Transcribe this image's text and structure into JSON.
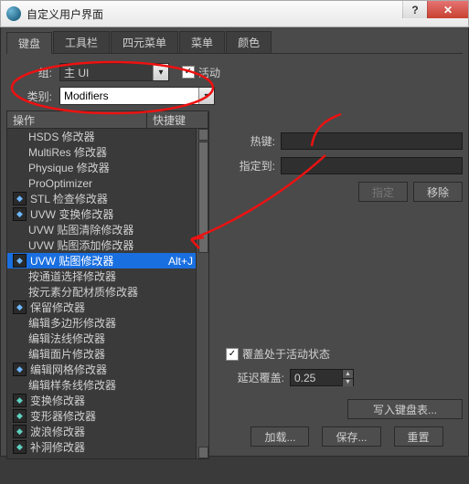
{
  "window": {
    "title": "自定义用户界面"
  },
  "tabs": [
    "键盘",
    "工具栏",
    "四元菜单",
    "菜单",
    "颜色"
  ],
  "active_tab": 0,
  "group": {
    "label": "组:",
    "value": "主 UI"
  },
  "active_cb": {
    "label": "活动",
    "checked": true
  },
  "category": {
    "label": "类别:",
    "value": "Modifiers"
  },
  "list": {
    "col_action": "操作",
    "col_hotkey": "快捷键",
    "items": [
      {
        "icon": "none",
        "label": "HSDS 修改器",
        "sc": ""
      },
      {
        "icon": "none",
        "label": "MultiRes 修改器",
        "sc": ""
      },
      {
        "icon": "none",
        "label": "Physique 修改器",
        "sc": ""
      },
      {
        "icon": "none",
        "label": "ProOptimizer",
        "sc": ""
      },
      {
        "icon": "box",
        "label": "STL 检查修改器",
        "sc": ""
      },
      {
        "icon": "box",
        "label": "UVW 变换修改器",
        "sc": ""
      },
      {
        "icon": "none",
        "label": "UVW 贴图清除修改器",
        "sc": ""
      },
      {
        "icon": "none",
        "label": "UVW 贴图添加修改器",
        "sc": ""
      },
      {
        "icon": "box",
        "label": "UVW 贴图修改器",
        "sc": "Alt+J",
        "selected": true
      },
      {
        "icon": "none",
        "label": "按通道选择修改器",
        "sc": ""
      },
      {
        "icon": "none",
        "label": "按元素分配材质修改器",
        "sc": ""
      },
      {
        "icon": "box",
        "label": "保留修改器",
        "sc": ""
      },
      {
        "icon": "none",
        "label": "编辑多边形修改器",
        "sc": ""
      },
      {
        "icon": "none",
        "label": "编辑法线修改器",
        "sc": ""
      },
      {
        "icon": "none",
        "label": "编辑面片修改器",
        "sc": ""
      },
      {
        "icon": "box",
        "label": "编辑网格修改器",
        "sc": ""
      },
      {
        "icon": "none",
        "label": "编辑样条线修改器",
        "sc": ""
      },
      {
        "icon": "teal",
        "label": "变换修改器",
        "sc": ""
      },
      {
        "icon": "teal",
        "label": "变形器修改器",
        "sc": ""
      },
      {
        "icon": "teal",
        "label": "波浪修改器",
        "sc": ""
      },
      {
        "icon": "teal",
        "label": "补洞修改器",
        "sc": ""
      }
    ]
  },
  "right": {
    "hotkey_label": "热键:",
    "assign_to_label": "指定到:",
    "assign_btn": "指定",
    "remove_btn": "移除",
    "override_cb": "覆盖处于活动状态",
    "delay_label": "延迟覆盖:",
    "delay_value": "0.25",
    "write_btn": "写入键盘表...",
    "load_btn": "加载...",
    "save_btn": "保存...",
    "reset_btn": "重置"
  }
}
